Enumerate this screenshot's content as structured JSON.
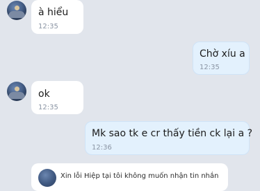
{
  "messages": [
    {
      "text": "à hiểu",
      "time": "12:35"
    },
    {
      "text": "Chờ xíu a",
      "time": "12:35"
    },
    {
      "text": "ok",
      "time": "12:35"
    },
    {
      "text": "Mk sao tk e cr thấy tiền ck lại a ?",
      "time": "12:36"
    }
  ],
  "notice": {
    "text": "Xin lỗi Hiệp tại tôi không muốn nhận tin nhắn"
  }
}
